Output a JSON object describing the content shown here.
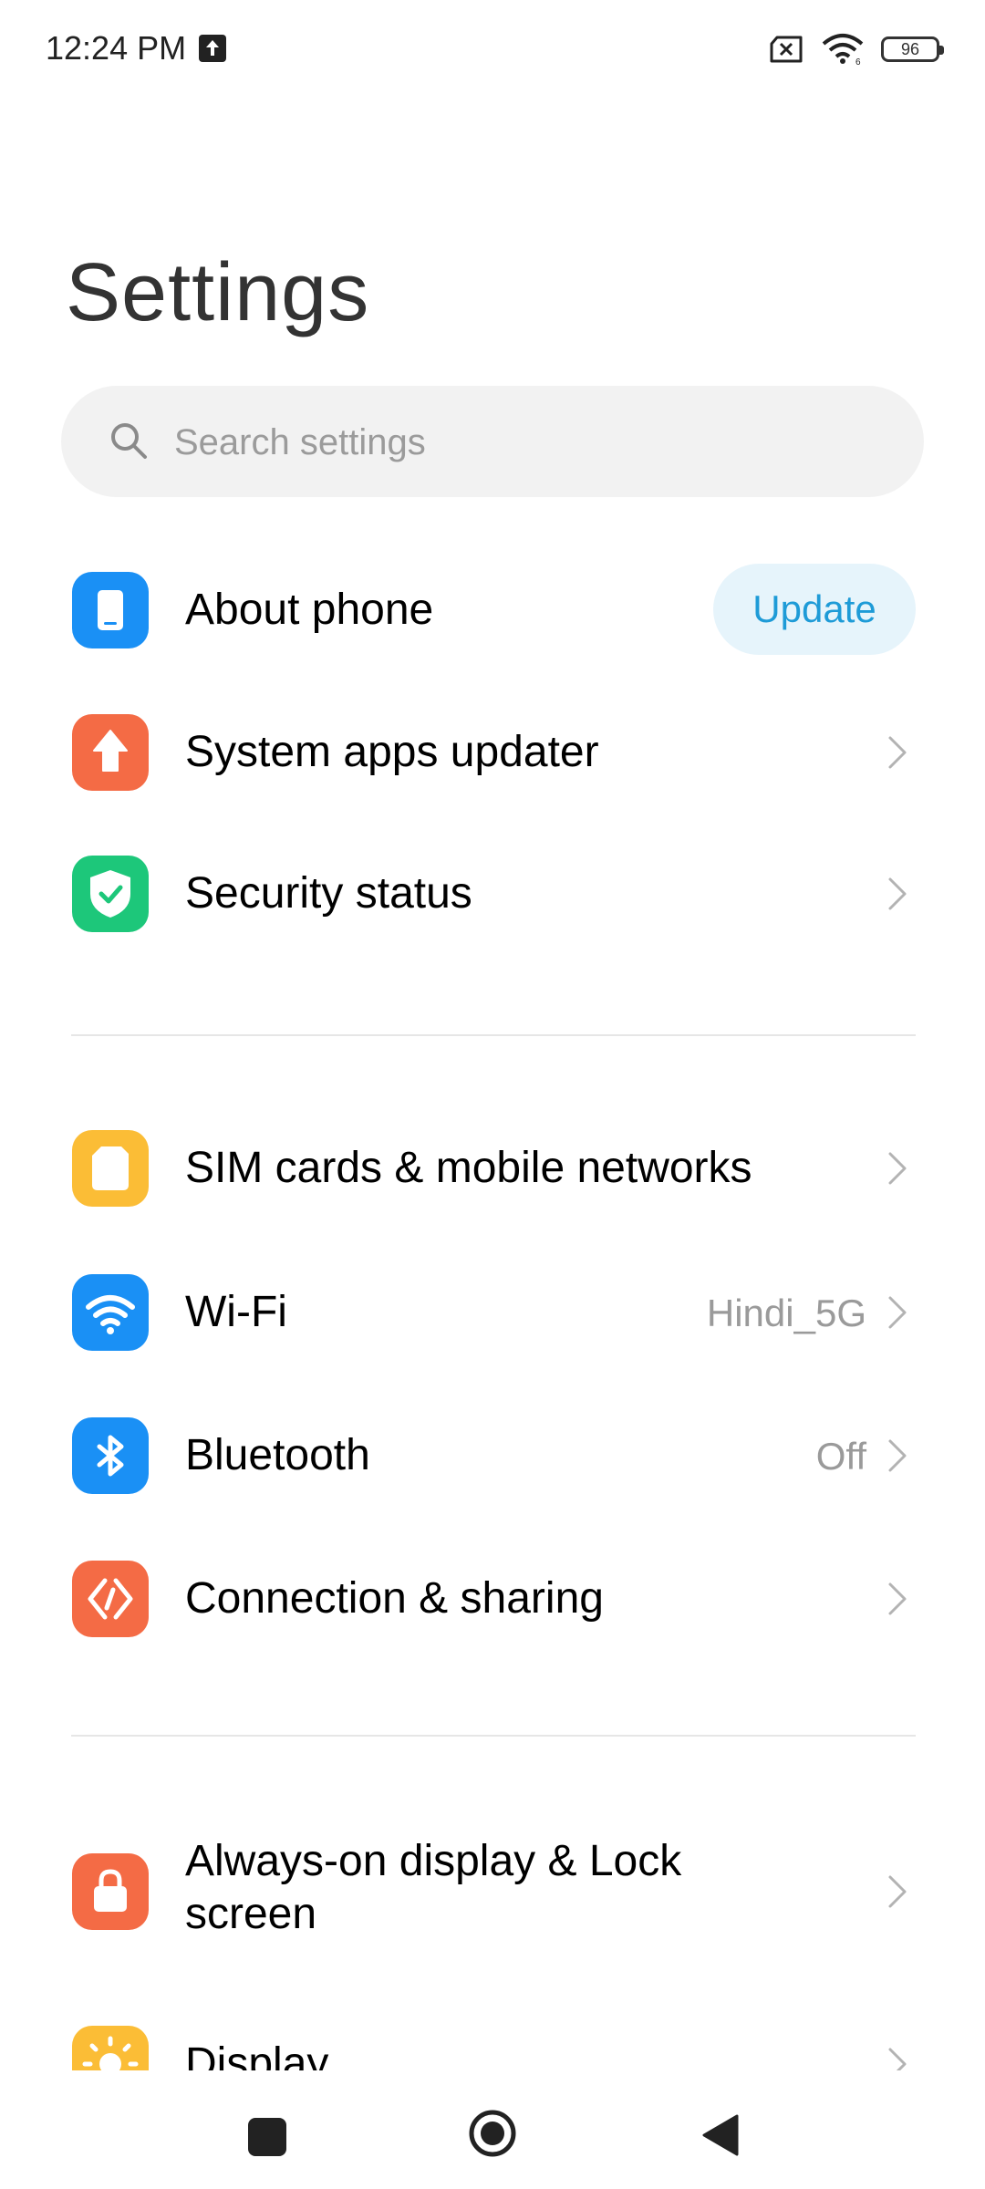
{
  "status_bar": {
    "time": "12:24 PM",
    "battery": "96",
    "icons": [
      "upload-icon",
      "sim-missing-icon",
      "wifi-icon",
      "battery-icon"
    ]
  },
  "page": {
    "title": "Settings"
  },
  "search": {
    "placeholder": "Search settings",
    "value": ""
  },
  "sections": [
    {
      "items": [
        {
          "label": "About phone",
          "icon": "phone-icon",
          "color": "#1a90f5",
          "action": "Update"
        },
        {
          "label": "System apps updater",
          "icon": "arrow-up-icon",
          "color": "#f46b45"
        },
        {
          "label": "Security status",
          "icon": "shield-check-icon",
          "color": "#1dc77a"
        }
      ]
    },
    {
      "items": [
        {
          "label": "SIM cards & mobile networks",
          "icon": "sim-card-icon",
          "color": "#fbbd36"
        },
        {
          "label": "Wi-Fi",
          "icon": "wifi-icon",
          "color": "#1a90f5",
          "value": "Hindi_5G"
        },
        {
          "label": "Bluetooth",
          "icon": "bluetooth-icon",
          "color": "#1a90f5",
          "value": "Off"
        },
        {
          "label": "Connection & sharing",
          "icon": "connection-icon",
          "color": "#f46b45"
        }
      ]
    },
    {
      "items": [
        {
          "label": "Always-on display & Lock screen",
          "icon": "lock-icon",
          "color": "#f46b45"
        },
        {
          "label": "Display",
          "icon": "sun-icon",
          "color": "#fbbd36"
        }
      ]
    }
  ],
  "nav_bar": {
    "buttons": [
      "recents-button",
      "home-button",
      "back-button"
    ]
  }
}
